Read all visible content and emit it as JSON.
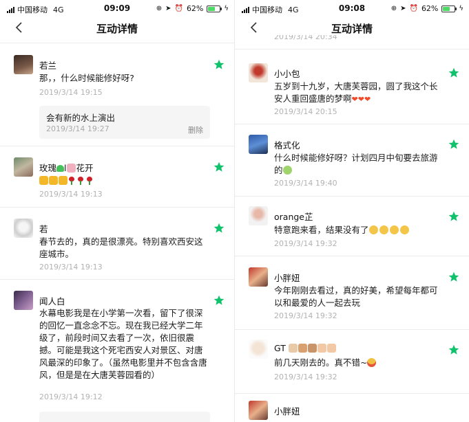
{
  "left": {
    "status": {
      "carrier": "中国移动",
      "network": "4G",
      "time": "09:09",
      "battery": "62%",
      "battery_level": 0.62
    },
    "nav": {
      "title": "互动详情"
    },
    "comments": [
      {
        "name": "若兰",
        "text": "那，，什么时候能修好呀?",
        "time": "2019/3/14 19:15",
        "reply": {
          "text": "会有新的水上演出",
          "time": "2019/3/14 19:27",
          "delete_label": "删除"
        }
      },
      {
        "name_prefix": "玫瑰",
        "name_mid": "l",
        "name_suffix": "花开",
        "time": "2019/3/14 19:13"
      },
      {
        "name": "若",
        "text": "春节去的，真的是很漂亮。特别喜欢西安这座城市。",
        "time": "2019/3/14 19:13"
      },
      {
        "name": "闻人白",
        "text": "水幕电影我是在小学第一次看，留下了很深的回忆一直念念不忘。现在我已经大学二年级了，前段时间又去看了一次，依旧很震撼。可能是我这个死宅西安人对景区、对唐风最深的印象了。（虽然电影里并不包含含唐风，但是是在大唐芙蓉园看的）",
        "time": "2019/3/14 19:12"
      }
    ]
  },
  "right": {
    "status": {
      "carrier": "中国移动",
      "network": "4G",
      "time": "09:08",
      "battery": "62%",
      "battery_level": 0.62
    },
    "nav": {
      "title": "互动详情"
    },
    "partial_time": "2019/3/14 20:34",
    "comments": [
      {
        "name": "小小包",
        "text": "五岁到十九岁，大唐芙蓉园，圆了我这个长安人重回盛唐的梦啊",
        "time": "2019/3/14 20:15"
      },
      {
        "name": "格式化",
        "text": "什么时候能修好呀？计划四月中旬要去旅游的",
        "time": "2019/3/14 19:40"
      },
      {
        "name": "orange芷",
        "text": "特意跑来看，结果没有了",
        "time": "2019/3/14 19:32"
      },
      {
        "name": "小胖妞",
        "text": "今年刚刚去看过，真的好美，希望每年都可以和最爱的人一起去玩",
        "time": "2019/3/14 19:32"
      },
      {
        "name": "GT",
        "text": "前几天刚去的。真不错~",
        "time": "2019/3/14 19:32"
      },
      {
        "name": "小胖妞"
      }
    ]
  },
  "colors": {
    "accent_star": "#10c26b",
    "time_gray": "#b2b2b2",
    "reply_bg": "#f5f5f5"
  },
  "icons": {
    "back": "chevron-left-icon",
    "favorite": "star-icon"
  }
}
